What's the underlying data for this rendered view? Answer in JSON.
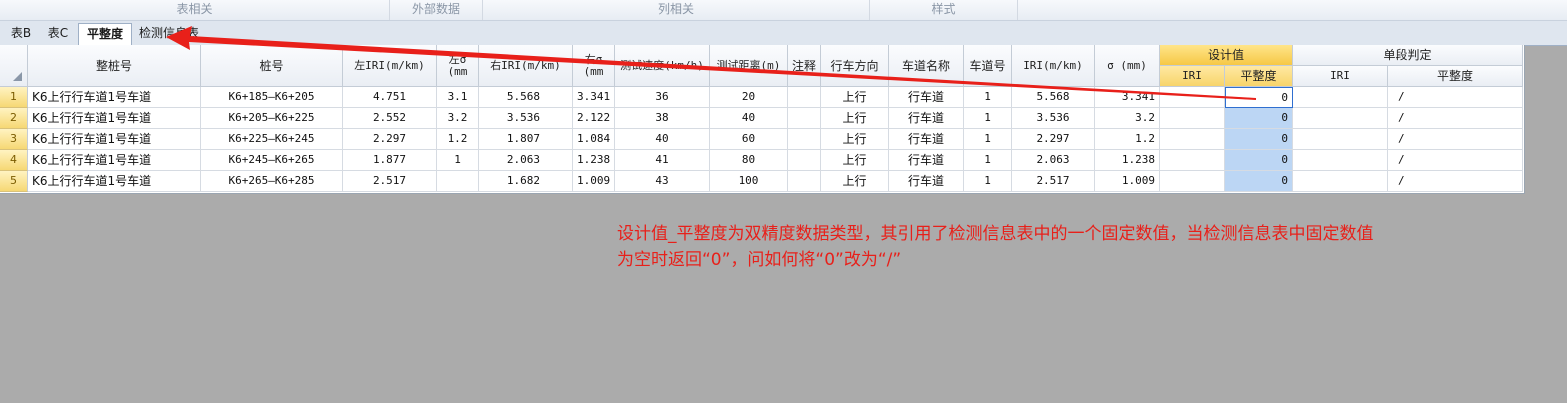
{
  "ribbon_groups": [
    "表相关",
    "外部数据",
    "列相关",
    "样式"
  ],
  "tabs": [
    "表B",
    "表C",
    "平整度",
    "检测信息表"
  ],
  "active_tab": "平整度",
  "headers": {
    "zhengzhuanghao": "整桩号",
    "zhuanghao": "桩号",
    "zuo_iri": "左IRI(m/km)",
    "zuo_sigma": "左σ (mm",
    "you_iri": "右IRI(m/km)",
    "you_sigma": "右σ (mm",
    "speed": "测试速度(km/h)",
    "distance": "测试距离(m)",
    "remark": "注释",
    "direction": "行车方向",
    "lane_name": "车道名称",
    "lane_no": "车道号",
    "iri": "IRI(m/km)",
    "sigma": "σ (mm)",
    "design_group": "设计值",
    "design_iri": "IRI",
    "design_flat": "平整度",
    "judge_group": "单段判定",
    "judge_iri": "IRI",
    "judge_flat": "平整度"
  },
  "rows": [
    {
      "n": "1",
      "zz": "K6上行行车道1号车道",
      "zh": "K6+185—K6+205",
      "zi": "4.751",
      "zs": "3.1",
      "yi": "5.568",
      "ys": "3.341",
      "sp": "36",
      "di": "20",
      "re": "",
      "dir": "上行",
      "ln": "行车道",
      "lno": "1",
      "iri": "5.568",
      "sg": "3.341",
      "diri": "",
      "dfl": "0",
      "jiri": "",
      "jfl": "/"
    },
    {
      "n": "2",
      "zz": "K6上行行车道1号车道",
      "zh": "K6+205—K6+225",
      "zi": "2.552",
      "zs": "3.2",
      "yi": "3.536",
      "ys": "2.122",
      "sp": "38",
      "di": "40",
      "re": "",
      "dir": "上行",
      "ln": "行车道",
      "lno": "1",
      "iri": "3.536",
      "sg": "3.2",
      "diri": "",
      "dfl": "0",
      "jiri": "",
      "jfl": "/"
    },
    {
      "n": "3",
      "zz": "K6上行行车道1号车道",
      "zh": "K6+225—K6+245",
      "zi": "2.297",
      "zs": "1.2",
      "yi": "1.807",
      "ys": "1.084",
      "sp": "40",
      "di": "60",
      "re": "",
      "dir": "上行",
      "ln": "行车道",
      "lno": "1",
      "iri": "2.297",
      "sg": "1.2",
      "diri": "",
      "dfl": "0",
      "jiri": "",
      "jfl": "/"
    },
    {
      "n": "4",
      "zz": "K6上行行车道1号车道",
      "zh": "K6+245—K6+265",
      "zi": "1.877",
      "zs": "1",
      "yi": "2.063",
      "ys": "1.238",
      "sp": "41",
      "di": "80",
      "re": "",
      "dir": "上行",
      "ln": "行车道",
      "lno": "1",
      "iri": "2.063",
      "sg": "1.238",
      "diri": "",
      "dfl": "0",
      "jiri": "",
      "jfl": "/"
    },
    {
      "n": "5",
      "zz": "K6上行行车道1号车道",
      "zh": "K6+265—K6+285",
      "zi": "2.517",
      "zs": "",
      "yi": "1.682",
      "ys": "1.009",
      "sp": "43",
      "di": "100",
      "re": "",
      "dir": "上行",
      "ln": "行车道",
      "lno": "1",
      "iri": "2.517",
      "sg": "1.009",
      "diri": "",
      "dfl": "0",
      "jiri": "",
      "jfl": "/"
    }
  ],
  "note_line1": "设计值_平整度为双精度数据类型，其引用了检测信息表中的一个固定数值，当检测信息表中固定数值",
  "note_line2": "为空时返回“0”，问如何将“0”改为“/”",
  "colors": {
    "annotation": "#e8201a",
    "design_header": "#f6c846",
    "selection": "#bcd6f4"
  }
}
